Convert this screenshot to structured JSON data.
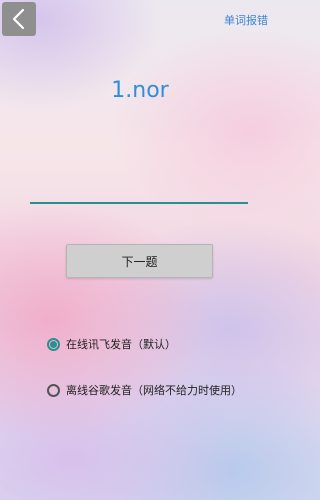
{
  "header": {
    "report_label": "单词报错"
  },
  "main": {
    "word": "1.nor",
    "input_value": "",
    "input_placeholder": "",
    "next_button_label": "下一题"
  },
  "options": [
    {
      "label": "在线讯飞发音（默认）",
      "selected": true
    },
    {
      "label": "离线谷歌发音（网络不给力时使用）",
      "selected": false
    }
  ],
  "colors": {
    "accent": "#2a8f8f",
    "link": "#3a86d4",
    "word": "#2f8ed8"
  },
  "icons": {
    "back": "chevron-left-icon"
  }
}
